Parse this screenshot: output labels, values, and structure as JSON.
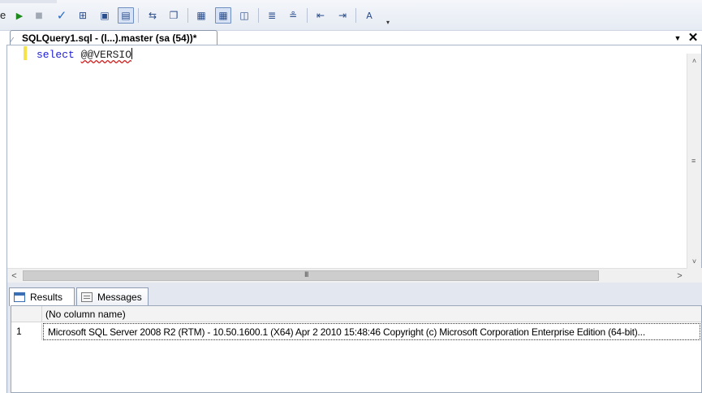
{
  "toolbar": {
    "leading_text": "e",
    "tools": [
      {
        "name": "execute-icon",
        "glyph": "▶",
        "color": "#1e8a1e"
      },
      {
        "name": "stop-icon",
        "glyph": "■",
        "color": "#a0a8b4"
      },
      {
        "name": "parse-icon",
        "glyph": "✓",
        "color": "#2a6bc4"
      },
      {
        "name": "estimated-plan-icon",
        "glyph": "⊞",
        "color": "#2b4e8c"
      },
      {
        "name": "query-designer-icon",
        "glyph": "▣",
        "color": "#2b4e8c"
      },
      {
        "name": "specify-values-icon",
        "glyph": "▤",
        "color": "#2b4e8c"
      },
      {
        "name": "analyze-query-icon",
        "glyph": "⇆",
        "color": "#2b4e8c"
      },
      {
        "name": "include-actual-plan-icon",
        "glyph": "❐",
        "color": "#2b4e8c"
      },
      {
        "name": "results-to-text-icon",
        "glyph": "▦",
        "color": "#2b4e8c"
      },
      {
        "name": "results-to-grid-icon",
        "glyph": "▦",
        "color": "#2b4e8c"
      },
      {
        "name": "results-to-file-icon",
        "glyph": "◫",
        "color": "#2b4e8c"
      },
      {
        "name": "comment-icon",
        "glyph": "≣",
        "color": "#2b4e8c"
      },
      {
        "name": "uncomment-icon",
        "glyph": "≗",
        "color": "#2b4e8c"
      },
      {
        "name": "decrease-indent-icon",
        "glyph": "⇤",
        "color": "#2b4e8c"
      },
      {
        "name": "increase-indent-icon",
        "glyph": "⇥",
        "color": "#2b4e8c"
      },
      {
        "name": "specify-template-values-icon",
        "glyph": "A",
        "color": "#2b4e8c"
      }
    ],
    "overflow_glyph": "▾"
  },
  "document_tab": {
    "title": "SQLQuery1.sql - (l...).master (sa (54))*"
  },
  "editor": {
    "keyword": "select",
    "identifier": "@@VERSIO"
  },
  "results": {
    "tabs": [
      {
        "label": "Results",
        "active": true
      },
      {
        "label": "Messages",
        "active": false
      }
    ],
    "column_header": "(No column name)",
    "rows": [
      {
        "num": "1",
        "value": "Microsoft SQL Server 2008 R2 (RTM) - 10.50.1600.1 (X64)   Apr  2 2010 15:48:46   Copyright (c) Microsoft Corporation  Enterprise Edition (64-bit)..."
      }
    ]
  },
  "scrollbar": {
    "up": "˄",
    "down": "˅",
    "left": "<",
    "right": ">",
    "grip_v": "≡",
    "grip_h": "III"
  }
}
